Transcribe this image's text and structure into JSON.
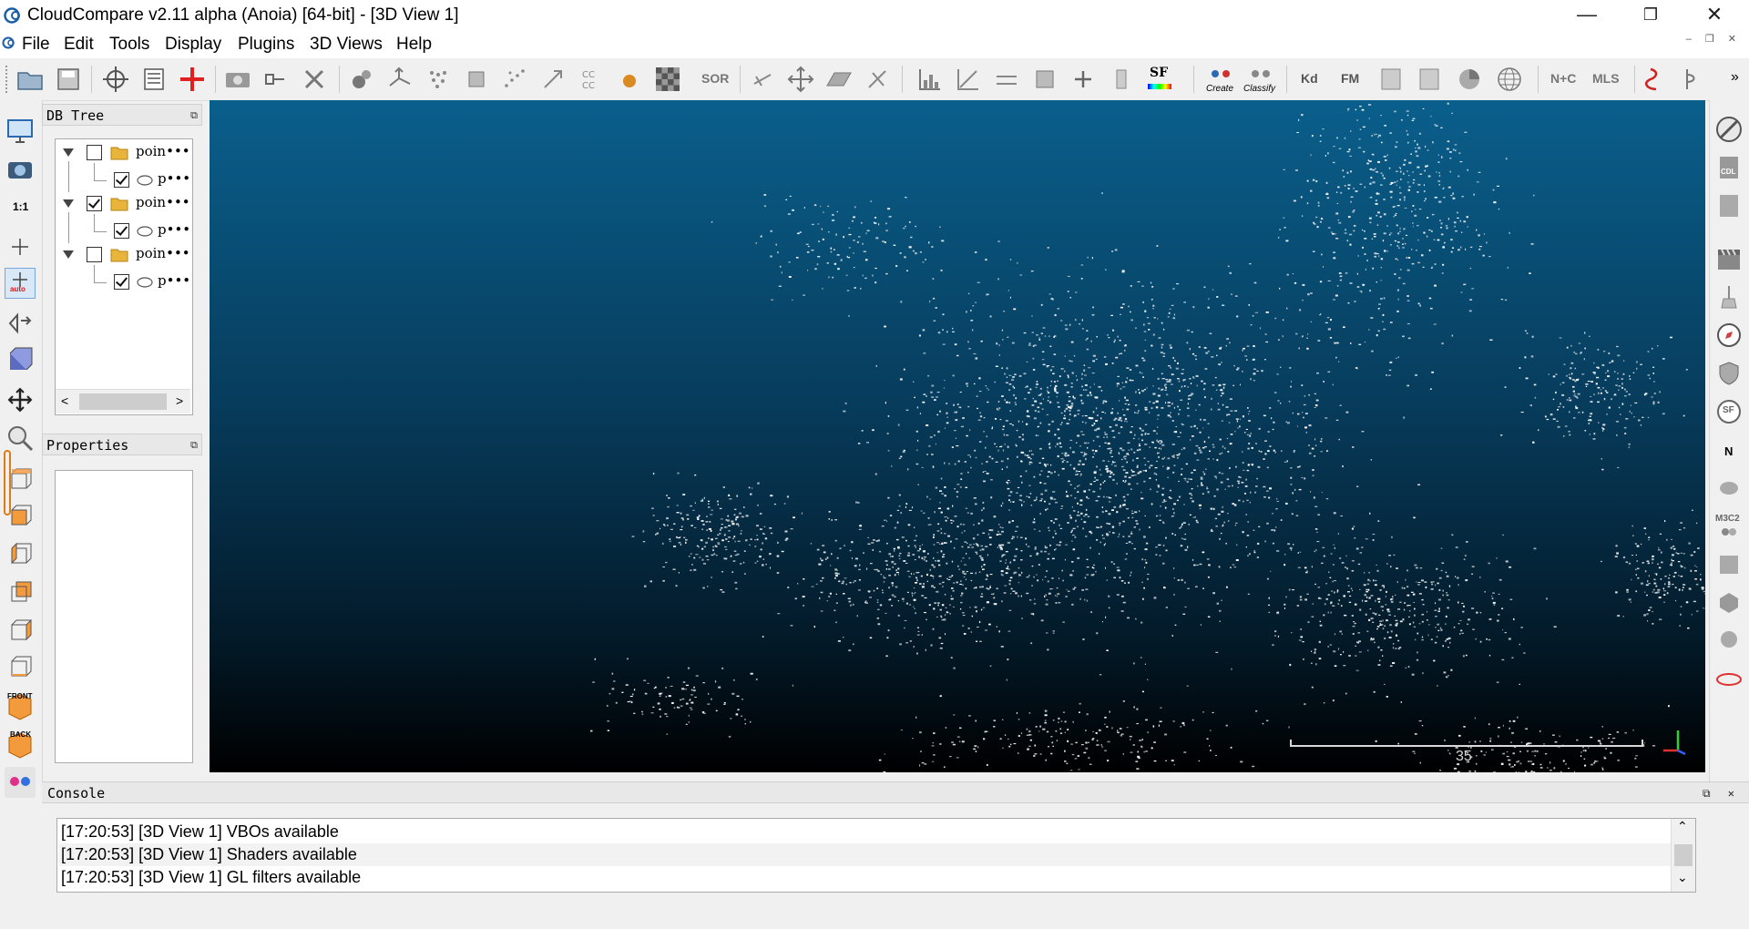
{
  "window": {
    "title": "CloudCompare v2.11 alpha (Anoia) [64-bit] - [3D View 1]",
    "minimize": "—",
    "maximize": "❐",
    "close": "✕"
  },
  "menu": [
    {
      "label": "File"
    },
    {
      "label": "Edit"
    },
    {
      "label": "Tools"
    },
    {
      "label": "Display"
    },
    {
      "label": "Plugins"
    },
    {
      "label": "3D Views"
    },
    {
      "label": "Help"
    }
  ],
  "toolbar": {
    "sor_label": "SOR",
    "sf_label": "SF",
    "canupo_create": "Create",
    "canupo_classify": "Classify",
    "kd_label": "Kd",
    "fm_label": "FM",
    "nc_label": "N+C",
    "mls_label": "MLS",
    "more": "»"
  },
  "left_toolbar": {
    "ratio_label": "1:1",
    "auto_label": "auto",
    "front_label": "FRONT",
    "back_label": "BACK"
  },
  "right_toolbar": {
    "cdl_label": "CDL",
    "n_label": "N",
    "m3c2_label": "M3C2",
    "sf_label": "SF"
  },
  "db_tree": {
    "title": "DB Tree",
    "items": [
      {
        "folder_label": "poin•••",
        "folder_checked": false,
        "child_label": "p•••",
        "child_checked": true
      },
      {
        "folder_label": "poin•••",
        "folder_checked": true,
        "child_label": "p•••",
        "child_checked": true
      },
      {
        "folder_label": "poin•••",
        "folder_checked": false,
        "child_label": "p•••",
        "child_checked": true
      }
    ],
    "scroll_left": "<",
    "scroll_right": ">"
  },
  "properties": {
    "title": "Properties"
  },
  "view3d": {
    "scale_value": "35"
  },
  "console": {
    "title": "Console",
    "lines": [
      "[17:20:53] [3D View 1] VBOs available",
      "[17:20:53] [3D View 1] Shaders available",
      "[17:20:53] [3D View 1] GL filters available"
    ]
  }
}
